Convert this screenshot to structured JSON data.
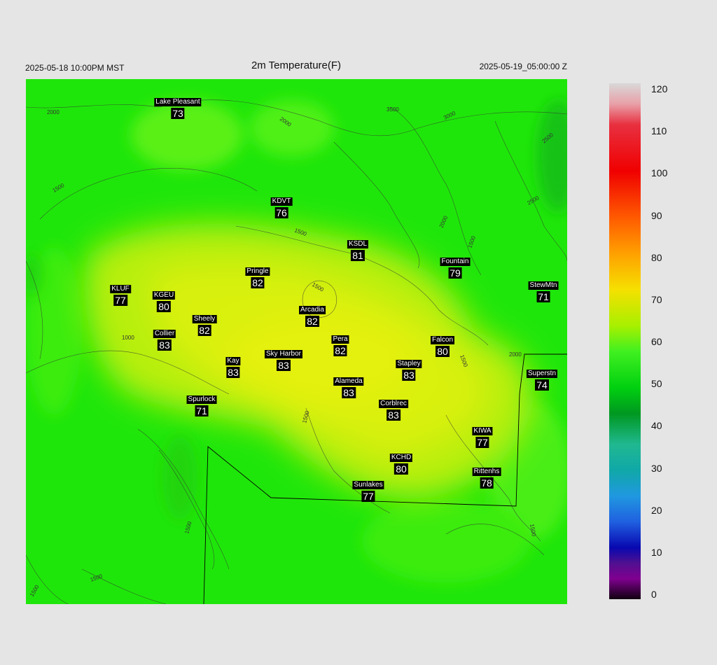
{
  "header": {
    "left": "2025-05-18 10:00PM MST",
    "title": "2m Temperature(F)",
    "right": "2025-05-19_05:00:00 Z"
  },
  "colorbar": {
    "ticks": [
      "120",
      "110",
      "100",
      "90",
      "80",
      "70",
      "60",
      "50",
      "40",
      "30",
      "20",
      "10",
      "0"
    ],
    "range": [
      0,
      120
    ]
  },
  "contour_labels": [
    "2000",
    "2000",
    "3500",
    "3000",
    "2500",
    "2000",
    "2500",
    "1500",
    "1500",
    "1500",
    "1500",
    "1000",
    "2000",
    "1500",
    "1500",
    "1500",
    "1500",
    "1500",
    "1500"
  ],
  "stations": [
    {
      "name": "Lake Pleasant",
      "value": "73"
    },
    {
      "name": "KDVT",
      "value": "76"
    },
    {
      "name": "KSDL",
      "value": "81"
    },
    {
      "name": "Fountain",
      "value": "79"
    },
    {
      "name": "Pringle",
      "value": "82"
    },
    {
      "name": "KLUF",
      "value": "77"
    },
    {
      "name": "KGEU",
      "value": "80"
    },
    {
      "name": "StewMtn",
      "value": "71"
    },
    {
      "name": "Arcadia",
      "value": "82"
    },
    {
      "name": "Sheely",
      "value": "82"
    },
    {
      "name": "Collier",
      "value": "83"
    },
    {
      "name": "Pera",
      "value": "82"
    },
    {
      "name": "Falcon",
      "value": "80"
    },
    {
      "name": "Sky Harbor",
      "value": "83"
    },
    {
      "name": "Kay",
      "value": "83"
    },
    {
      "name": "Stapley",
      "value": "83"
    },
    {
      "name": "Superstn",
      "value": "74"
    },
    {
      "name": "Alameda",
      "value": "83"
    },
    {
      "name": "Spurlock",
      "value": "71"
    },
    {
      "name": "Corblrec",
      "value": "83"
    },
    {
      "name": "KIWA",
      "value": "77"
    },
    {
      "name": "KCHD",
      "value": "80"
    },
    {
      "name": "Rittenhs",
      "value": "78"
    },
    {
      "name": "Sunlakes",
      "value": "77"
    }
  ]
}
